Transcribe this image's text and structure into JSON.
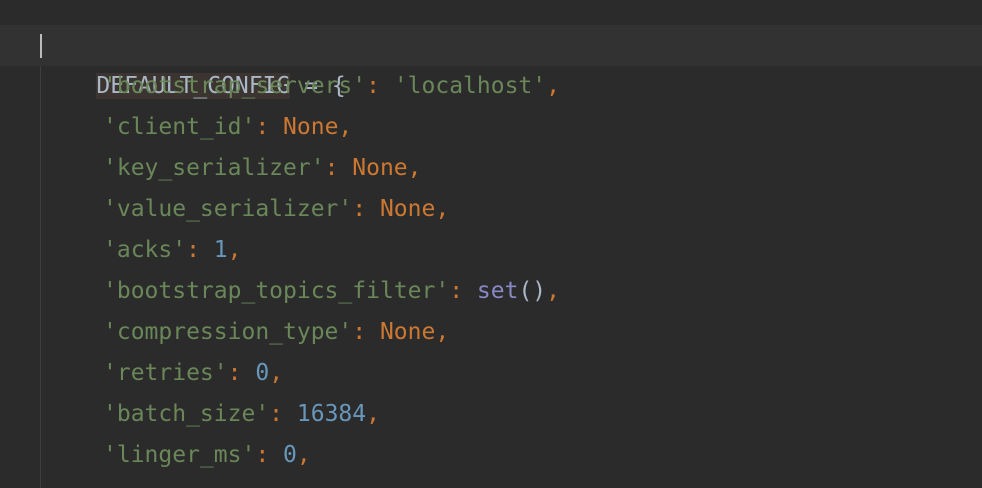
{
  "editor": {
    "colors": {
      "background": "#2b2b2b",
      "current_line": "#323232",
      "default_text": "#a9b7c6",
      "string": "#6a8759",
      "keyword": "#cc7832",
      "number": "#6897bb",
      "builtin": "#8888c6",
      "docstring": "#629755"
    },
    "top_partial_line": "\"\"\"",
    "assignment": {
      "variable": "DEFAULT_CONFIG",
      "operator": " = ",
      "open_brace": "{"
    },
    "entries": [
      {
        "key": "'bootstrap_servers'",
        "value": "'localhost'",
        "value_kind": "string"
      },
      {
        "key": "'client_id'",
        "value": "None",
        "value_kind": "keyword"
      },
      {
        "key": "'key_serializer'",
        "value": "None",
        "value_kind": "keyword"
      },
      {
        "key": "'value_serializer'",
        "value": "None",
        "value_kind": "keyword"
      },
      {
        "key": "'acks'",
        "value": "1",
        "value_kind": "number"
      },
      {
        "key": "'bootstrap_topics_filter'",
        "value": "set",
        "value_kind": "builtin",
        "value_suffix": "()"
      },
      {
        "key": "'compression_type'",
        "value": "None",
        "value_kind": "keyword"
      },
      {
        "key": "'retries'",
        "value": "0",
        "value_kind": "number"
      },
      {
        "key": "'batch_size'",
        "value": "16384",
        "value_kind": "number"
      },
      {
        "key": "'linger_ms'",
        "value": "0",
        "value_kind": "number"
      }
    ],
    "colon": ": ",
    "comma": ","
  }
}
